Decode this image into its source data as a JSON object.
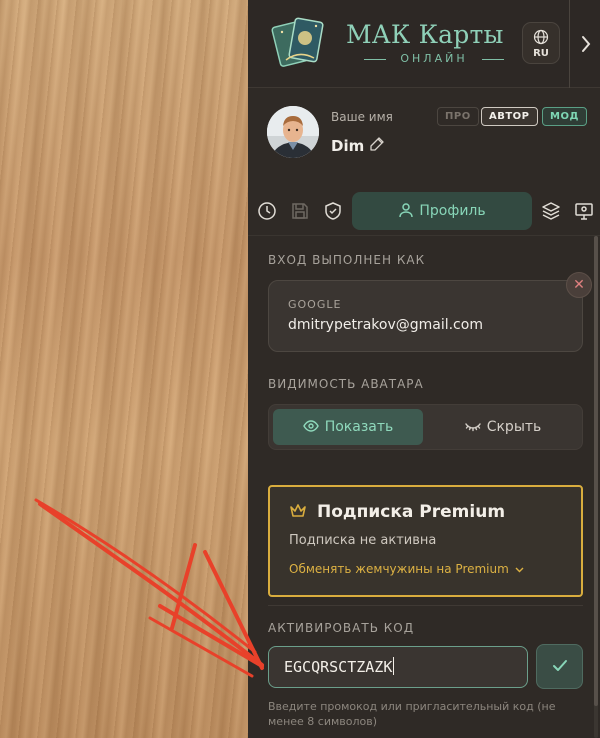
{
  "header": {
    "app_title": "МАК Карты",
    "app_subtitle": "ОНЛАЙН",
    "language": "RU",
    "icons": {
      "language": "globe-icon",
      "expand": "chevron-right-icon"
    }
  },
  "profile": {
    "name_label": "Ваше имя",
    "name": "Dim",
    "badges": {
      "pro": "ПРО",
      "author": "АВТОР",
      "mod": "МОД"
    }
  },
  "tabs": {
    "icons": [
      "clock-icon",
      "save-icon",
      "shield-check-icon",
      "layers-icon",
      "monitor-icon"
    ],
    "active_label": "Профиль"
  },
  "login": {
    "section_title": "ВХОД ВЫПОЛНЕН КАК",
    "provider": "GOOGLE",
    "email": "dmitrypetrakov@gmail.com"
  },
  "avatar_visibility": {
    "section_title": "ВИДИМОСТЬ АВАТАРА",
    "show_label": "Показать",
    "hide_label": "Скрыть",
    "selected": "Показать"
  },
  "premium": {
    "title": "Подписка Premium",
    "status": "Подписка не активна",
    "exchange_link": "Обменять жемчужины на Premium"
  },
  "activation": {
    "section_title": "АКТИВИРОВАТЬ КОД",
    "code_value": "EGCQRSCTZAZK",
    "hint": "Введите промокод или пригласительный код (не менее 8 символов)"
  },
  "colors": {
    "accent": "#88d6b8",
    "premium_gold": "#d9ad3e",
    "panel_bg": "#2f2a26",
    "annotation_arrow": "#e8412a"
  }
}
